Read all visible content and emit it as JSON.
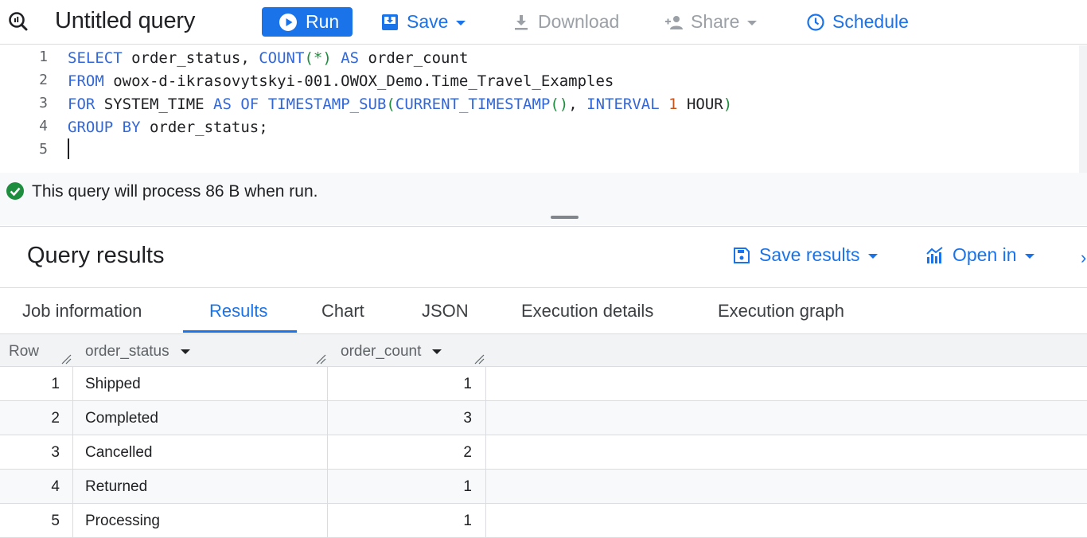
{
  "toolbar": {
    "title": "Untitled query",
    "run_label": "Run",
    "save_label": "Save",
    "download_label": "Download",
    "share_label": "Share",
    "schedule_label": "Schedule"
  },
  "editor": {
    "line_numbers": [
      "1",
      "2",
      "3",
      "4",
      "5"
    ],
    "lines": [
      [
        {
          "t": "SELECT",
          "c": "kw"
        },
        {
          "t": " order_status, ",
          "c": ""
        },
        {
          "t": "COUNT",
          "c": "kw"
        },
        {
          "t": "(*)",
          "c": "paren"
        },
        {
          "t": " ",
          "c": ""
        },
        {
          "t": "AS",
          "c": "kw"
        },
        {
          "t": " order_count",
          "c": ""
        }
      ],
      [
        {
          "t": "FROM",
          "c": "kw"
        },
        {
          "t": " owox-d-ikrasovytskyi-001.OWOX_Demo.Time_Travel_Examples",
          "c": ""
        }
      ],
      [
        {
          "t": "FOR",
          "c": "kw"
        },
        {
          "t": " SYSTEM_TIME ",
          "c": ""
        },
        {
          "t": "AS OF",
          "c": "kw"
        },
        {
          "t": " ",
          "c": ""
        },
        {
          "t": "TIMESTAMP_SUB",
          "c": "kw"
        },
        {
          "t": "(",
          "c": "paren"
        },
        {
          "t": "CURRENT_TIMESTAMP",
          "c": "kw"
        },
        {
          "t": "()",
          "c": "paren"
        },
        {
          "t": ", ",
          "c": ""
        },
        {
          "t": "INTERVAL",
          "c": "kw"
        },
        {
          "t": " ",
          "c": ""
        },
        {
          "t": "1",
          "c": "num"
        },
        {
          "t": " HOUR",
          "c": ""
        },
        {
          "t": ")",
          "c": "paren"
        }
      ],
      [
        {
          "t": "GROUP BY",
          "c": "kw"
        },
        {
          "t": " order_status;",
          "c": ""
        }
      ],
      []
    ]
  },
  "validation": {
    "message": "This query will process 86 B when run.",
    "status_color": "#1e8e3e"
  },
  "results": {
    "title": "Query results",
    "save_results_label": "Save results",
    "open_in_label": "Open in"
  },
  "tabs": {
    "job_information": "Job information",
    "results": "Results",
    "chart": "Chart",
    "json": "JSON",
    "execution_details": "Execution details",
    "execution_graph": "Execution graph"
  },
  "table": {
    "headers": {
      "row": "Row",
      "order_status": "order_status",
      "order_count": "order_count"
    },
    "rows": [
      {
        "row": "1",
        "order_status": "Shipped",
        "order_count": "1"
      },
      {
        "row": "2",
        "order_status": "Completed",
        "order_count": "3"
      },
      {
        "row": "3",
        "order_status": "Cancelled",
        "order_count": "2"
      },
      {
        "row": "4",
        "order_status": "Returned",
        "order_count": "1"
      },
      {
        "row": "5",
        "order_status": "Processing",
        "order_count": "1"
      }
    ]
  },
  "colors": {
    "accent": "#1a73e8",
    "keyword": "#3367d6",
    "number": "#c5561b",
    "paren": "#1e8e3e"
  }
}
